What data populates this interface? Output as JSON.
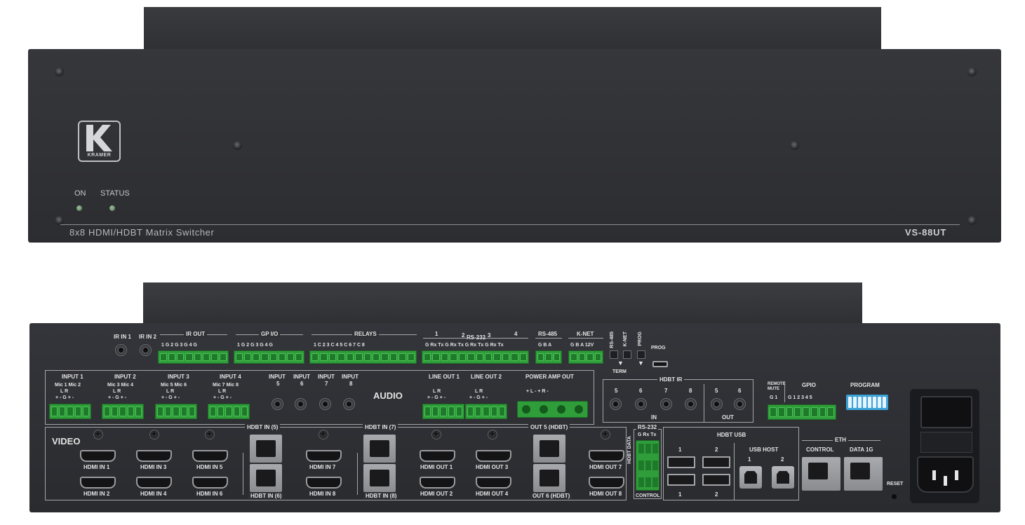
{
  "front": {
    "logo_text": "KRAMER",
    "on_label": "ON",
    "status_label": "STATUS",
    "model_description": "8x8 HDMI/HDBT Matrix Switcher",
    "model_name": "VS-88UT"
  },
  "rear": {
    "ir_in_1": "IR IN 1",
    "ir_in_2": "IR IN 2",
    "ir_out": "IR OUT",
    "ir_out_pins": "1 G 2 G  3 G 4 G",
    "gpio_top": "GP I/O",
    "gpio_top_pins": "1 G 2 G  3 G 4 G",
    "relays": "RELAYS",
    "relays_pins": "1 C 2  3 C 4  5 C 6  7 C 8",
    "rs232_top": "RS-232",
    "rs232_nums": [
      "1",
      "2",
      "3",
      "4"
    ],
    "rs232_pins": "G Rx Tx  G Rx Tx  G Rx Tx  G Rx Tx",
    "rs485": "RS-485",
    "rs485_pins": "G  B  A",
    "knet": "K-NET",
    "knet_pins": "G  B  A 12V",
    "term_rs485": "RS-485",
    "term_knet": "K-NET",
    "term_label": "TERM",
    "prog_switch": "PROG",
    "prog_port": "PROG",
    "audio_inputs": [
      {
        "title": "INPUT 1",
        "sub": "Mic 1   Mic 2",
        "lr": "L         R",
        "pins": "+  -  G  +  -"
      },
      {
        "title": "INPUT 2",
        "sub": "Mic 3   Mic 4",
        "lr": "L         R",
        "pins": "+  -  G  +  -"
      },
      {
        "title": "INPUT 3",
        "sub": "Mic 5   Mic 6",
        "lr": "L         R",
        "pins": "+  -  G  +  -"
      },
      {
        "title": "INPUT 4",
        "sub": "Mic 7   Mic 8",
        "lr": "L         R",
        "pins": "+  -  G  +  -"
      }
    ],
    "audio_jack_inputs": [
      {
        "title": "INPUT",
        "num": "5"
      },
      {
        "title": "INPUT",
        "num": "6"
      },
      {
        "title": "INPUT",
        "num": "7"
      },
      {
        "title": "INPUT",
        "num": "8"
      }
    ],
    "audio_label": "AUDIO",
    "line_out_1": "LINE OUT 1",
    "line_out_2": "LINE OUT 2",
    "line_out_lr": "L         R",
    "line_out_pins": "+  -  G  +  -",
    "power_amp_out": "POWER AMP OUT",
    "power_amp_pins": "+  L  -     +  R  -",
    "hdbt_ir": "HDBT IR",
    "hdbt_ir_nums": [
      "5",
      "6",
      "7",
      "8",
      "5",
      "6"
    ],
    "hdbt_ir_in": "IN",
    "hdbt_ir_out": "OUT",
    "remote_mute": "REMOTE MUTE",
    "remote_mute_pins": "G  1",
    "gpio_right": "GPIO",
    "gpio_right_pins": "G  1  2  3  4  5",
    "program": "PROGRAM",
    "video_label": "VIDEO",
    "hdmi_in_top": [
      "HDMI IN 1",
      "HDMI IN 3",
      "HDMI IN 5"
    ],
    "hdmi_in_bottom": [
      "HDMI IN 2",
      "HDMI IN 4",
      "HDMI IN 6"
    ],
    "hdbt_in_5": "HDBT IN (5)",
    "hdbt_in_6": "HDBT IN (6)",
    "hdmi_in_7": "HDMI IN 7",
    "hdmi_in_8": "HDMI IN 8",
    "hdbt_in_7": "HDBT IN (7)",
    "hdbt_in_8": "HDBT IN (8)",
    "hdmi_out_top": [
      "HDMI OUT 1",
      "HDMI OUT 3"
    ],
    "hdmi_out_bottom": [
      "HDMI OUT 2",
      "HDMI OUT 4"
    ],
    "out_5_hdbt": "OUT 5 (HDBT)",
    "out_6_hdbt": "OUT 6 (HDBT)",
    "hdmi_out_7": "HDMI OUT 7",
    "hdmi_out_8": "HDMI OUT 8",
    "hdbt_data": "HDBT DATA",
    "rs232_right": "RS-232",
    "rs232_right_pins": "G Rx Tx",
    "control_label": "CONTROL",
    "hdbt_usb": "HDBT USB",
    "hdbt_usb_nums_top": [
      "1",
      "2"
    ],
    "hdbt_usb_nums_bottom": [
      "1",
      "2"
    ],
    "usb_host": "USB HOST",
    "usb_host_nums": [
      "1",
      "2"
    ],
    "eth": "ETH",
    "eth_control": "CONTROL",
    "eth_data": "DATA 1G",
    "reset": "RESET"
  }
}
